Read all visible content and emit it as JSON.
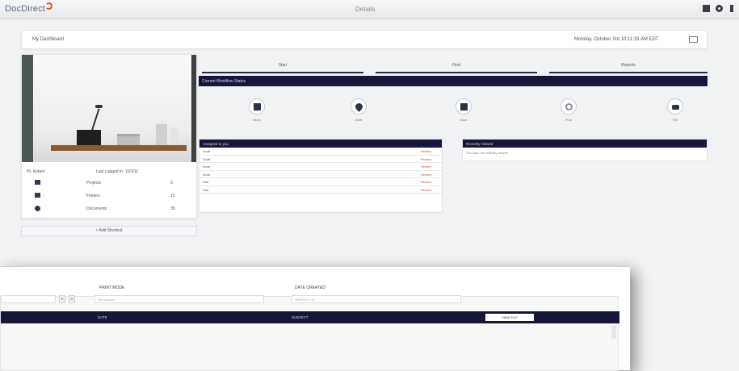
{
  "topbar": {
    "brand": "DocDirect",
    "nav_title": "Details"
  },
  "header": {
    "title": "My Dashboard",
    "date": "Monday, October 3rd 10:11:33 AM EDT"
  },
  "profile": {
    "user_name": "Hi, Robert",
    "last_logged": "Last Logged In: 10/3/11",
    "stats": [
      {
        "label": "Projects",
        "count": "3"
      },
      {
        "label": "Folders",
        "count": "15"
      },
      {
        "label": "Documents",
        "count": "35"
      }
    ],
    "add_button": "+ Add Shortcut"
  },
  "tabs": [
    "Start",
    "Find",
    "Reports"
  ],
  "workflow": {
    "title": "Current Workflow Status",
    "items": [
      {
        "label": "Inbox",
        "icon": "document-icon"
      },
      {
        "label": "Draft",
        "icon": "drop-icon"
      },
      {
        "label": "Save",
        "icon": "save-icon"
      },
      {
        "label": "Find",
        "icon": "search-icon"
      },
      {
        "label": "File",
        "icon": "camera-icon"
      }
    ]
  },
  "assigned": {
    "title": "Assigned to you",
    "link_label": "Review",
    "rows": [
      "Scott",
      "Scott",
      "Scott",
      "Scott",
      "Dee",
      "Dee"
    ]
  },
  "recent": {
    "title": "Recently Viewed",
    "empty_text": "You have not recently viewed"
  },
  "lower": {
    "filters": [
      {
        "label": "PRINT MODE",
        "placeholder": "File Upload"
      },
      {
        "label": "DATE CREATED",
        "placeholder": "MM/DD/YYYY"
      }
    ],
    "columns": [
      "DATE",
      "SUBJECT"
    ],
    "view_button": "VIEW FILE"
  },
  "colors": {
    "navy": "#15163a",
    "accent": "#d34a3b",
    "brand": "#e0522b"
  }
}
